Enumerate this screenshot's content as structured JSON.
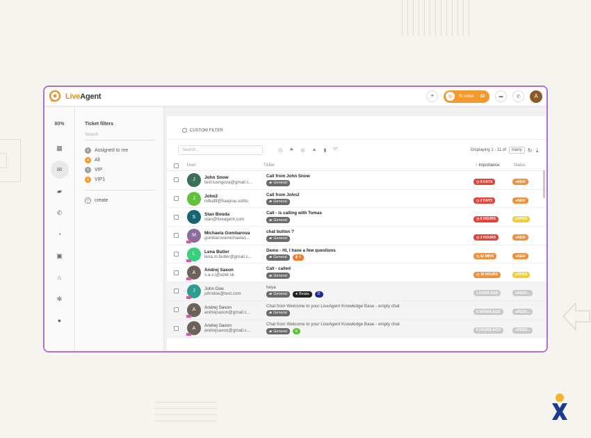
{
  "brand": {
    "name_part1": "Live",
    "name_part2": "Agent"
  },
  "topbar": {
    "to_solve_label": "To solve",
    "to_solve_count": "10",
    "avatar_initial": "A"
  },
  "leftnav": {
    "zoom": "80%"
  },
  "filters": {
    "title": "Ticket filters",
    "search_placeholder": "Search",
    "items": [
      {
        "label": "Assigned to me",
        "badge": "0",
        "color": "grey"
      },
      {
        "label": "All",
        "badge": "4",
        "color": "orange"
      },
      {
        "label": "VIP",
        "badge": "0",
        "color": "grey"
      },
      {
        "label": "VIP1",
        "badge": "3",
        "color": "orange"
      }
    ],
    "create_label": "create"
  },
  "panel": {
    "custom_filter_label": "CUSTOM FILTER",
    "search_placeholder": "Search...",
    "displaying": "Displaying 1 - 11 of",
    "many": "many"
  },
  "table": {
    "headers": {
      "user": "User",
      "ticket": "Ticket",
      "importance": "Importance",
      "status": "Status"
    },
    "rows": [
      {
        "name": "John Snow",
        "email": "test.luongova@gmail.c...",
        "initial": "J",
        "avatar_color": "#3d6e58",
        "subject": "Call from John Snow",
        "tags": [
          {
            "label": "General",
            "kind": "default"
          }
        ],
        "importance": "8 DAYS",
        "imp_kind": "red",
        "status": "NEW",
        "status_kind": "orange",
        "read": false
      },
      {
        "name": "John2",
        "email": "mfkaflf@fiaejkse.sofds",
        "initial": "J",
        "avatar_color": "#62c23a",
        "subject": "Call from John2",
        "tags": [
          {
            "label": "General",
            "kind": "default"
          }
        ],
        "importance": "2 DAYS",
        "imp_kind": "red",
        "status": "NEW",
        "status_kind": "orange",
        "read": false
      },
      {
        "name": "Stan Bouda",
        "email": "stan@liveagent.com",
        "initial": "S",
        "avatar_color": "#176374",
        "subject": "Call - is calling with Tomas",
        "tags": [
          {
            "label": "General",
            "kind": "default"
          }
        ],
        "importance": "6 HOURS",
        "imp_kind": "red",
        "status": "OPEN",
        "status_kind": "yellow",
        "read": false
      },
      {
        "name": "Michaela Gombarova",
        "email": "gombarovamichaela1...",
        "initial": "M",
        "avatar_color": "#8a6d9a",
        "subject": "chat button ?",
        "tags": [
          {
            "label": "General",
            "kind": "default"
          }
        ],
        "importance": "2 HOURS",
        "imp_kind": "red",
        "status": "NEW",
        "status_kind": "orange",
        "read": false
      },
      {
        "name": "Lena Butler",
        "email": "lena.m.butler@gmail.c...",
        "initial": "L",
        "avatar_color": "#33d17a",
        "subject": "Demo - Hi, I have a few questions",
        "tags": [
          {
            "label": "General",
            "kind": "default"
          },
          {
            "label": "II",
            "kind": "orange"
          }
        ],
        "importance": "42 MINS",
        "imp_kind": "orange",
        "status": "NEW",
        "status_kind": "orange",
        "read": false
      },
      {
        "name": "Andrej Saxon",
        "email": "s.a.x.i@azet.sk",
        "initial": "A",
        "avatar_color": "#6d6158",
        "subject": "Call - called",
        "tags": [
          {
            "label": "General",
            "kind": "default"
          }
        ],
        "importance": "18 HOURS",
        "imp_kind": "orange",
        "status": "OPEN",
        "status_kind": "yellow",
        "read": false
      },
      {
        "name": "John Doe",
        "email": "johndoe@test.com",
        "initial": "J",
        "avatar_color": "#2f9d8f",
        "subject": "heya",
        "tags": [
          {
            "label": "General",
            "kind": "default"
          },
          {
            "label": "Beata",
            "kind": "black"
          },
          {
            "label": "D",
            "kind": "navy"
          }
        ],
        "importance": "1 HOUR AGO",
        "imp_kind": "grey",
        "status": "RESO...",
        "status_kind": "grey",
        "read": true
      },
      {
        "name": "Andrej Saxon",
        "email": "andrejsaxon@gmail.c...",
        "initial": "A",
        "avatar_color": "#6d6158",
        "subject": "Chat from Welcome to your LiveAgent Knowledge Base - empty chat",
        "tags": [
          {
            "label": "General",
            "kind": "default"
          }
        ],
        "importance": "5 HOURS AGO",
        "imp_kind": "grey",
        "status": "RESO...",
        "status_kind": "grey",
        "read": true
      },
      {
        "name": "Andrej Saxon",
        "email": "andrejsaxon@gmail.c...",
        "initial": "A",
        "avatar_color": "#6d6158",
        "subject": "Chat from Welcome to your LiveAgent Knowledge Base - empty chat",
        "tags": [
          {
            "label": "General",
            "kind": "default"
          },
          {
            "label": "K",
            "kind": "green"
          }
        ],
        "importance": "6 HOURS AGO",
        "imp_kind": "grey",
        "status": "RESO...",
        "status_kind": "grey",
        "read": true
      }
    ]
  },
  "colors": {
    "accent": "#f29a2e",
    "frame": "#b36bd8",
    "danger": "#e4433a"
  }
}
